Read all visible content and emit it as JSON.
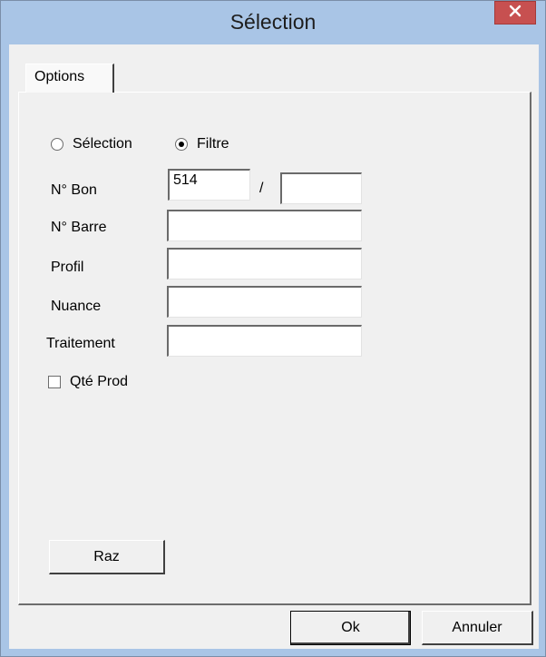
{
  "window": {
    "title": "Sélection",
    "close_icon": "close-icon"
  },
  "tabs": [
    {
      "label": "Options",
      "selected": true
    }
  ],
  "mode": {
    "options": [
      {
        "label": "Sélection",
        "checked": false
      },
      {
        "label": "Filtre",
        "checked": true
      }
    ]
  },
  "fields": {
    "bon_label": "N° Bon",
    "bon_value": "514",
    "bon_separator": "/",
    "bon_value2": "",
    "barre_label": "N° Barre",
    "barre_value": "",
    "profil_label": "Profil",
    "profil_value": "",
    "nuance_label": "Nuance",
    "nuance_value": "",
    "traitement_label": "Traitement",
    "traitement_value": ""
  },
  "qte_prod": {
    "label": "Qté Prod",
    "checked": false
  },
  "buttons": {
    "raz": "Raz",
    "ok": "Ok",
    "annuler": "Annuler"
  },
  "colors": {
    "titlebar": "#a9c5e6",
    "close_button": "#c75050",
    "dialog_face": "#f0f0f0"
  }
}
